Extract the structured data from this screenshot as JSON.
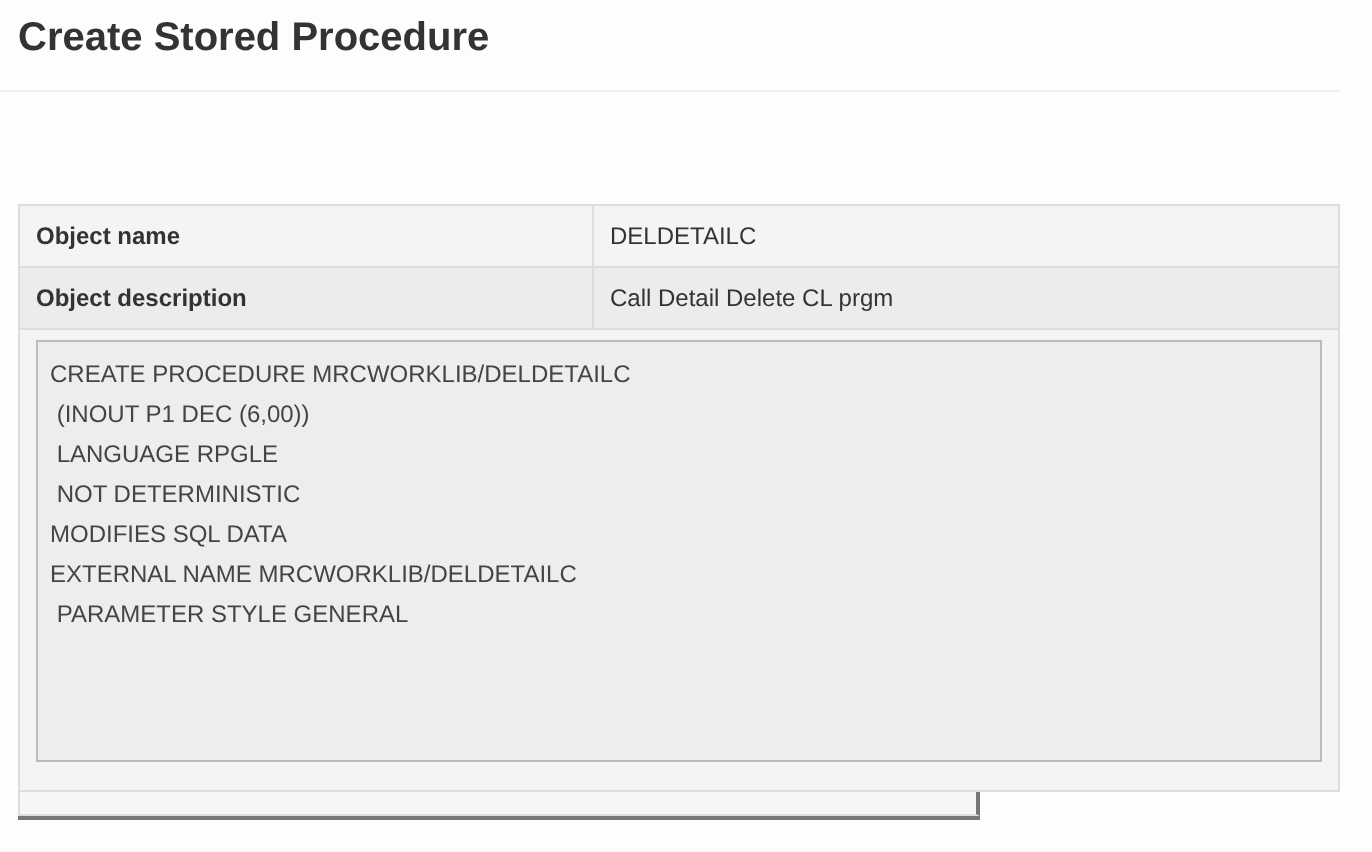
{
  "page": {
    "title": "Create Stored Procedure"
  },
  "properties": [
    {
      "label": "Object name",
      "value": "DELDETAILC"
    },
    {
      "label": "Object description",
      "value": "Call Detail Delete CL prgm"
    }
  ],
  "sql_lines": [
    "CREATE PROCEDURE MRCWORKLIB/DELDETAILC",
    " (INOUT P1 DEC (6,00))",
    " LANGUAGE RPGLE",
    " NOT DETERMINISTIC",
    "MODIFIES SQL DATA",
    "EXTERNAL NAME MRCWORKLIB/DELDETAILC",
    " PARAMETER STYLE GENERAL"
  ]
}
